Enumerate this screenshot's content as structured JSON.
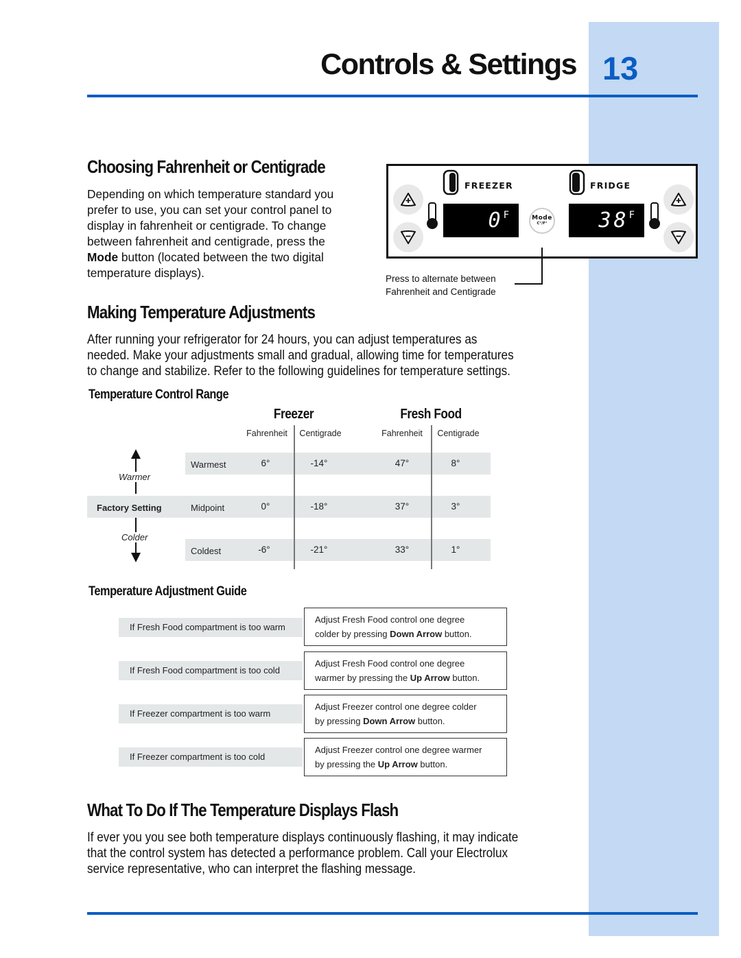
{
  "header": {
    "title": "Controls & Settings",
    "page_number": "13",
    "accent_color": "#0a5dc2",
    "sidebar_color": "#c3d9f4"
  },
  "section_fahrenheit": {
    "heading": "Choosing Fahrenheit or Centigrade",
    "lines": [
      "Depending on which temperature standard you",
      "prefer to use, you can set your control panel to",
      "display in fahrenheit or centigrade. To change",
      "between fahrenheit and centigrade, press the"
    ],
    "line5_bold": "Mode",
    "line5_rest": " button (located between the two digital",
    "line6": "temperature displays)."
  },
  "control_panel": {
    "freezer_label": "FREEZER",
    "fridge_label": "FRIDGE",
    "freezer_display": "0",
    "fridge_display": "38",
    "unit": "F",
    "mode_label": "Mode",
    "mode_sub": "C°/F°",
    "up_icon": "plus-triangle-up",
    "down_icon": "minus-triangle-down",
    "callout_line1": "Press to alternate between",
    "callout_line2": "Fahrenheit and Centigrade"
  },
  "section_adjust": {
    "heading": "Making Temperature Adjustments",
    "lines": [
      "After running your refrigerator for 24 hours, you can adjust temperatures as",
      "needed. Make your adjustments small and gradual, allowing time for temperatures",
      "to change and stabilize. Refer to the following guidelines for temperature settings."
    ]
  },
  "range_table": {
    "heading": "Temperature Control Range",
    "groups": [
      "Freezer",
      "Fresh Food"
    ],
    "subheaders": [
      "Fahrenheit",
      "Centigrade",
      "Fahrenheit",
      "Centigrade"
    ],
    "warmer_label": "Warmer",
    "colder_label": "Colder",
    "factory_label": "Factory Setting",
    "rows": [
      {
        "label": "Warmest",
        "values": [
          "6°",
          "-14°",
          "47°",
          "8°"
        ]
      },
      {
        "label": "Midpoint",
        "values": [
          "0°",
          "-18°",
          "37°",
          "3°"
        ]
      },
      {
        "label": "Coldest",
        "values": [
          "-6°",
          "-21°",
          "33°",
          "1°"
        ]
      }
    ]
  },
  "adjustment_guide": {
    "heading": "Temperature Adjustment Guide",
    "items": [
      {
        "condition": "If Fresh Food compartment is too warm",
        "line1": "Adjust Fresh Food control one degree",
        "line2_pre": "colder by pressing ",
        "line2_bold": "Down Arrow",
        "line2_post": " button."
      },
      {
        "condition": "If Fresh Food compartment is too cold",
        "line1": "Adjust Fresh Food control one degree",
        "line2_pre": "warmer by pressing the ",
        "line2_bold": "Up Arrow",
        "line2_post": " button."
      },
      {
        "condition": "If Freezer compartment is too warm",
        "line1": "Adjust Freezer control one degree colder",
        "line2_pre": "by pressing ",
        "line2_bold": "Down Arrow",
        "line2_post": " button."
      },
      {
        "condition": "If Freezer compartment is too cold",
        "line1": "Adjust Freezer control one degree warmer",
        "line2_pre": "by pressing the ",
        "line2_bold": "Up Arrow",
        "line2_post": " button."
      }
    ]
  },
  "section_flash": {
    "heading": "What To Do If The Temperature Displays Flash",
    "lines": [
      "If ever you you see both temperature displays continuously flashing, it may indicate",
      "that the control system has detected a performance problem. Call your Electrolux",
      "service representative, who can interpret the flashing message."
    ]
  }
}
